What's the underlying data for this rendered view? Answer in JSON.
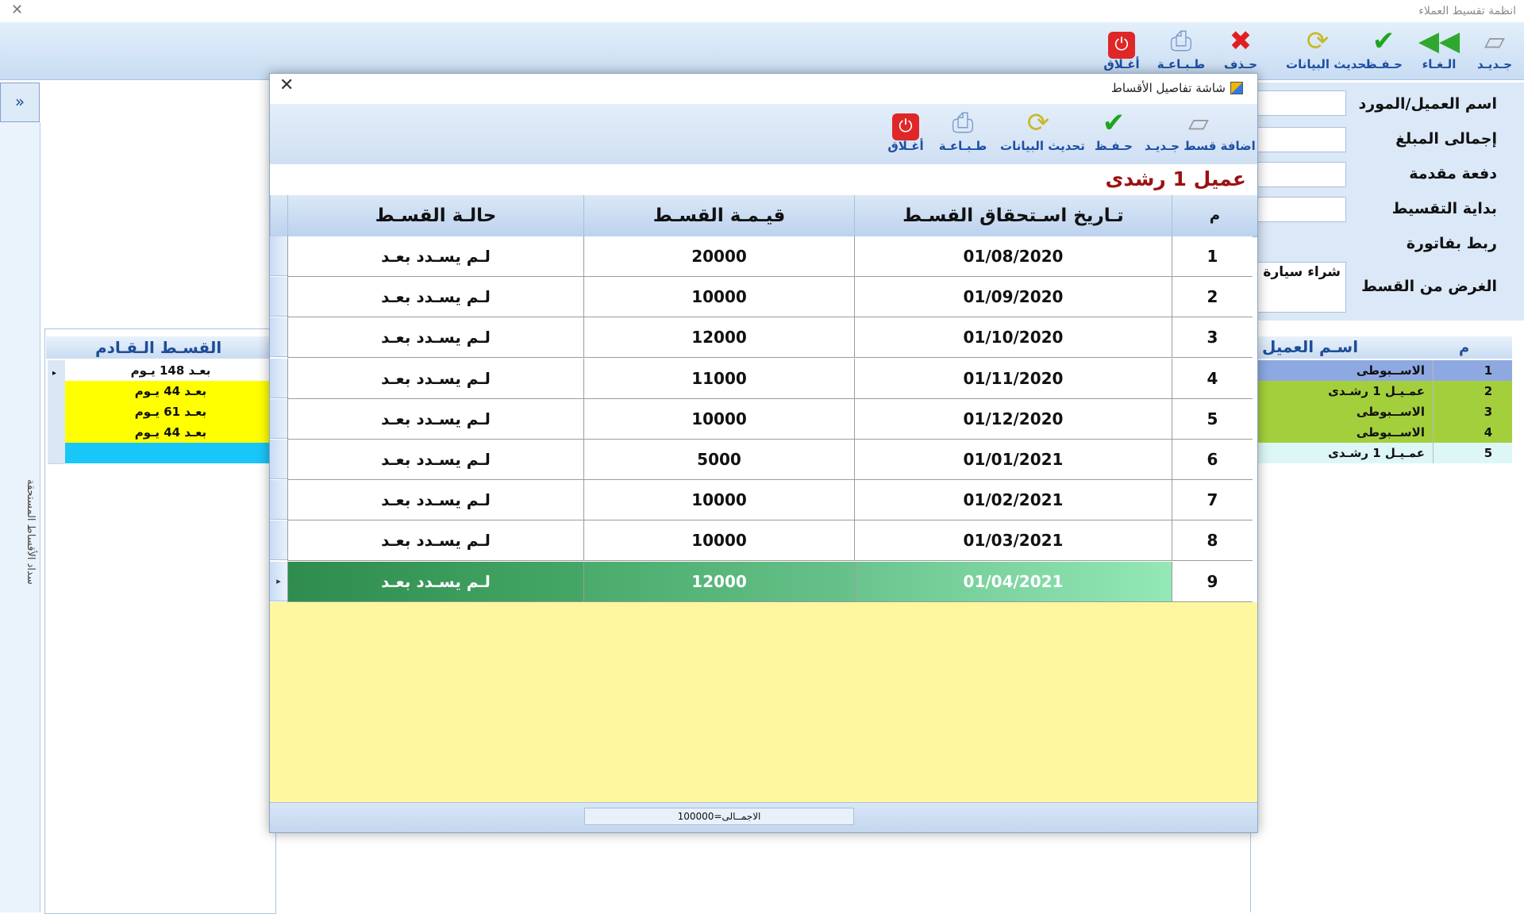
{
  "app": {
    "title": "انظمة تقسيط العملاء"
  },
  "main_toolbar": [
    {
      "name": "new",
      "label": "جـديـد",
      "icon": "new-icon"
    },
    {
      "name": "undo",
      "label": "الـغـاء",
      "icon": "double-arrow-left-icon"
    },
    {
      "name": "save",
      "label": "حـفـظ",
      "icon": "checkmark-icon"
    },
    {
      "name": "refresh",
      "label": "تحديث البيانات",
      "icon": "refresh-icon"
    },
    {
      "name": "delete",
      "label": "حـذف",
      "icon": "delete-x-icon"
    },
    {
      "name": "print",
      "label": "طـبـاعـة",
      "icon": "printer-icon"
    },
    {
      "name": "close",
      "label": "أغـلاق",
      "icon": "power-icon"
    }
  ],
  "side_panel": {
    "collapse_glyph": "»",
    "label": "سداد الأقساط المستحقة"
  },
  "form": {
    "customer_label": "اسم العميل/المورد",
    "total_label": "إجمالى المبلغ",
    "down_payment_label": "دفعة مقدمة",
    "start_label": "بداية التقسيط",
    "invoice_label": "ربط بفاتورة",
    "purpose_label": "الغرض من القسط",
    "purpose_value": "شراء سيارة"
  },
  "left_grid": {
    "header": "القسـط الـقـادم",
    "rows": [
      {
        "text": "بعـد 148 يـوم",
        "bg": "#ffffff",
        "current": true
      },
      {
        "text": "بعـد 44 يـوم",
        "bg": "#ffff00"
      },
      {
        "text": "بعـد 61 يـوم",
        "bg": "#ffff00"
      },
      {
        "text": "بعـد 44 يـوم",
        "bg": "#ffff00"
      },
      {
        "text": "",
        "bg": "#19c6f8"
      }
    ]
  },
  "right_grid": {
    "header_name": "اسـم العميل",
    "header_num": "م",
    "rows": [
      {
        "no": "1",
        "name": "الاســبوطى",
        "bg": "#8ea9e2"
      },
      {
        "no": "2",
        "name": "عمـيـل 1 رشـدى",
        "bg": "#a4cf3c"
      },
      {
        "no": "3",
        "name": "الاســبوطى",
        "bg": "#a4cf3c"
      },
      {
        "no": "4",
        "name": "الاســبوطى",
        "bg": "#a4cf3c"
      },
      {
        "no": "5",
        "name": "عمـيـل 1 رشـدى",
        "bg": "#ddf7f7"
      }
    ]
  },
  "dialog": {
    "title": "شاشة تفاصيل الأقساط",
    "toolbar": [
      {
        "name": "add-installment",
        "label": "اضافة قسط جـديـد",
        "icon": "new-icon"
      },
      {
        "name": "save",
        "label": "حـفـظ",
        "icon": "checkmark-icon"
      },
      {
        "name": "refresh",
        "label": "تحديث البيانات",
        "icon": "refresh-icon"
      },
      {
        "name": "print",
        "label": "طـبـاعـة",
        "icon": "printer-icon"
      },
      {
        "name": "close",
        "label": "أغـلاق",
        "icon": "power-icon"
      }
    ],
    "customer_name": "عميل 1 رشدى",
    "columns": {
      "num": "م",
      "date": "تـاريخ اسـتحقاق القسـط",
      "value": "قيـمـة القسـط",
      "status": "حالـة القسـط"
    },
    "rows": [
      {
        "num": "1",
        "date": "01/08/2020",
        "value": "20000",
        "status": "لـم يسـدد بعـد"
      },
      {
        "num": "2",
        "date": "01/09/2020",
        "value": "10000",
        "status": "لـم يسـدد بعـد"
      },
      {
        "num": "3",
        "date": "01/10/2020",
        "value": "12000",
        "status": "لـم يسـدد بعـد"
      },
      {
        "num": "4",
        "date": "01/11/2020",
        "value": "11000",
        "status": "لـم يسـدد بعـد"
      },
      {
        "num": "5",
        "date": "01/12/2020",
        "value": "10000",
        "status": "لـم يسـدد بعـد"
      },
      {
        "num": "6",
        "date": "01/01/2021",
        "value": "5000",
        "status": "لـم يسـدد بعـد"
      },
      {
        "num": "7",
        "date": "01/02/2021",
        "value": "10000",
        "status": "لـم يسـدد بعـد"
      },
      {
        "num": "8",
        "date": "01/03/2021",
        "value": "10000",
        "status": "لـم يسـدد بعـد"
      },
      {
        "num": "9",
        "date": "01/04/2021",
        "value": "12000",
        "status": "لـم يسـدد بعـد",
        "selected": true
      }
    ],
    "total": "الاجمــالى=100000"
  }
}
